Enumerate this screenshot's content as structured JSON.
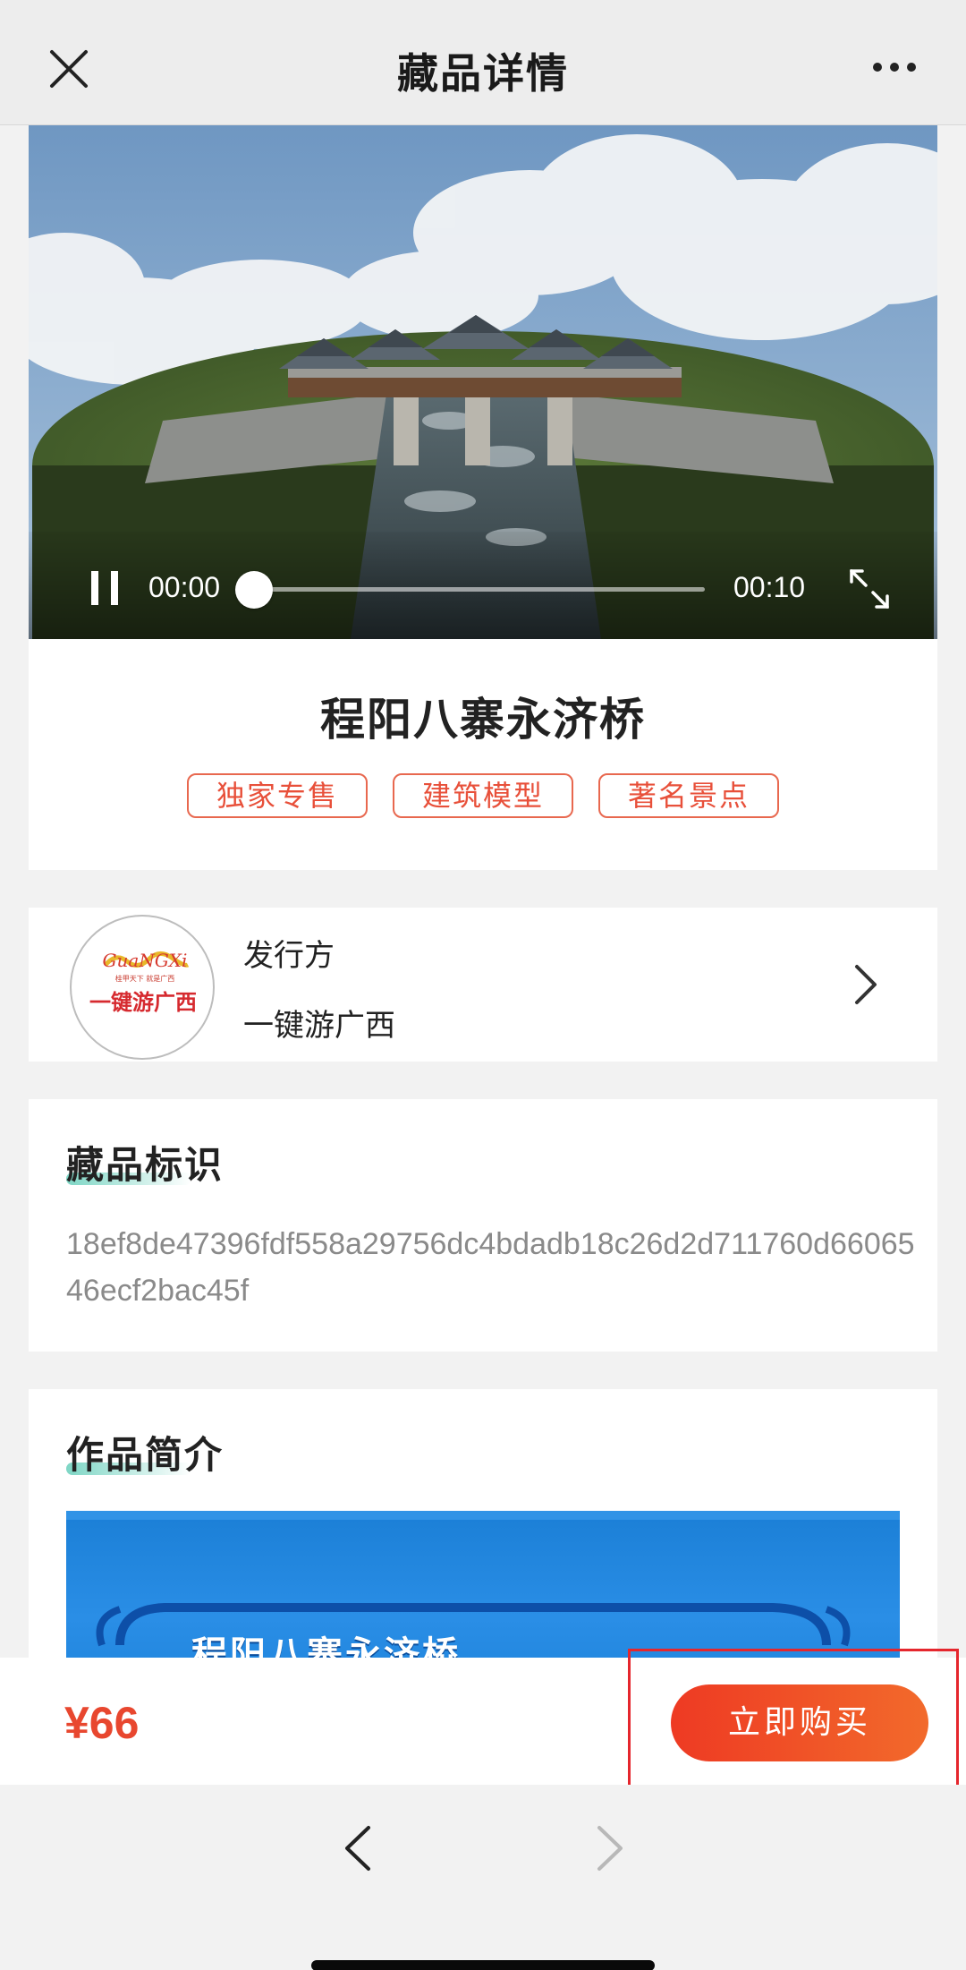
{
  "header": {
    "title": "藏品详情",
    "close_icon": "close-icon",
    "more_icon": "more-icon"
  },
  "video": {
    "current_time": "00:00",
    "duration": "00:10",
    "progress": 0,
    "state": "playing",
    "pause_icon": "pause-icon",
    "fullscreen_icon": "fullscreen-icon"
  },
  "product": {
    "name": "程阳八寨永济桥",
    "tags": [
      "独家专售",
      "建筑模型",
      "著名景点"
    ]
  },
  "issuer": {
    "label": "发行方",
    "name": "一键游广西",
    "logo_text": "一键游广西",
    "logo_script": "GuaNGXi",
    "logo_slogan": "桂甲天下 就是广西"
  },
  "identifier": {
    "title": "藏品标识",
    "hash": "18ef8de47396fdf558a29756dc4bdadb18c26d2d711760d6606546ecf2bac45f"
  },
  "intro": {
    "title": "作品简介",
    "banner_title": "程阳八寨永济桥"
  },
  "purchase": {
    "price": "¥66",
    "buy_label": "立即购买"
  },
  "colors": {
    "accent": "#ee3a23",
    "tag_border": "#e8684f",
    "underline": "#7ed6c5",
    "highlight": "#e5262d"
  }
}
